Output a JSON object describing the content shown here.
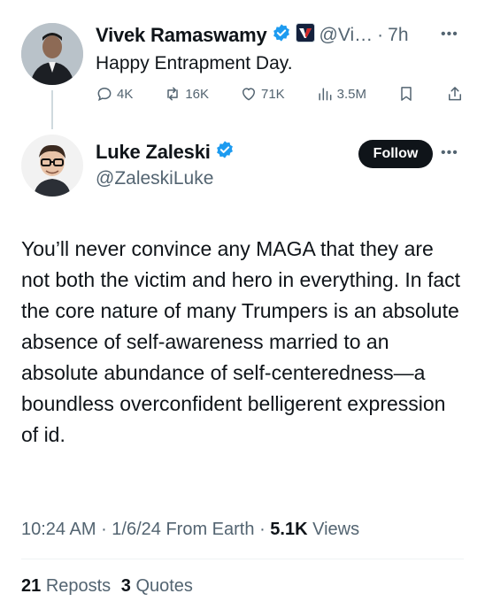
{
  "quoted_tweet": {
    "author_name": "Vivek Ramaswamy",
    "handle": "@Vi…",
    "separator": "·",
    "time": "7h",
    "text": "Happy Entrapment Day.",
    "stats": {
      "replies": "4K",
      "reposts": "16K",
      "likes": "71K",
      "views": "3.5M"
    }
  },
  "main_tweet": {
    "author_name": "Luke Zaleski",
    "handle": "@ZaleskiLuke",
    "follow_label": "Follow",
    "text": "You’ll never convince any MAGA that they are not both the victim and hero in everything. In fact the core nature of many Trumpers is an absolute absence of self-awareness married to an absolute abundance of self-centeredness—a boundless overconfident belligerent expression of id.",
    "time": "10:24 AM",
    "date": "1/6/24",
    "location": "From Earth",
    "views_count": "5.1K",
    "views_label": "Views",
    "reposts_count": "21",
    "reposts_label": "Reposts",
    "quotes_count": "3",
    "quotes_label": "Quotes"
  },
  "colors": {
    "text": "#0f1419",
    "muted": "#536471",
    "verified": "#1d9bf0",
    "divider": "#eff3f4"
  }
}
